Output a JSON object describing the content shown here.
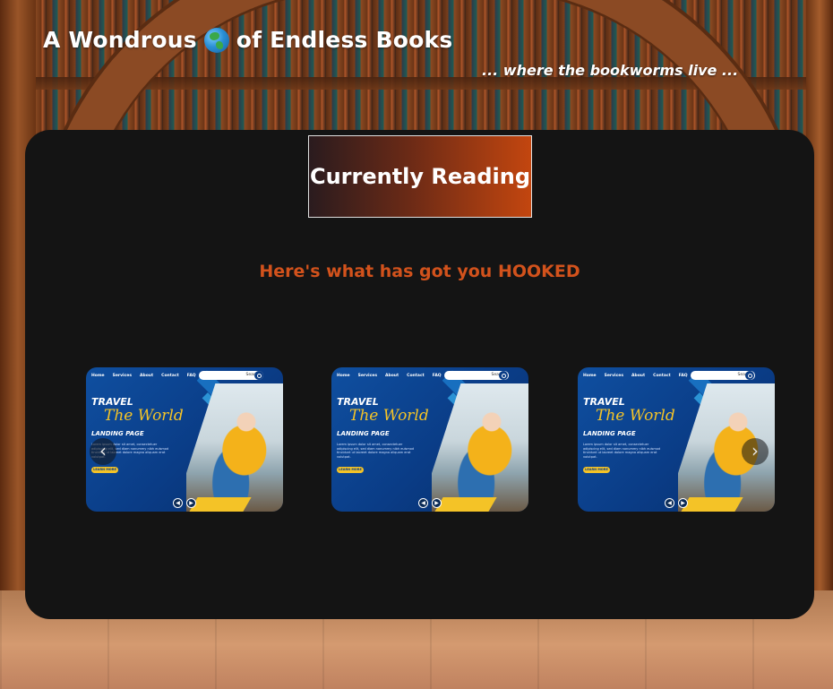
{
  "site": {
    "title_prefix": "A Wondrous",
    "title_suffix": "of Endless Books",
    "tagline": "... where the bookworms live ..."
  },
  "section": {
    "heading": "Currently Reading",
    "subheading": "Here's what has got you HOOKED"
  },
  "cards": [
    {
      "nav": [
        "Home",
        "Services",
        "About",
        "Contact",
        "FAQ"
      ],
      "search": "Search",
      "travel": "TRAVEL",
      "world": "The World",
      "landing": "LANDING PAGE",
      "lorem": "Lorem ipsum dolor sit amet, consectetuer adipiscing elit, sed diam nonummy nibh euismod tincidunt ut laoreet dolore magna aliquam erat volutpat.",
      "button": "LEARN MORE"
    },
    {
      "nav": [
        "Home",
        "Services",
        "About",
        "Contact",
        "FAQ"
      ],
      "search": "Search",
      "travel": "TRAVEL",
      "world": "The World",
      "landing": "LANDING PAGE",
      "lorem": "Lorem ipsum dolor sit amet, consectetuer adipiscing elit, sed diam nonummy nibh euismod tincidunt ut laoreet dolore magna aliquam erat volutpat.",
      "button": "LEARN MORE"
    },
    {
      "nav": [
        "Home",
        "Services",
        "About",
        "Contact",
        "FAQ"
      ],
      "search": "Search",
      "travel": "TRAVEL",
      "world": "The World",
      "landing": "LANDING PAGE",
      "lorem": "Lorem ipsum dolor sit amet, consectetuer adipiscing elit, sed diam nonummy nibh euismod tincidunt ut laoreet dolore magna aliquam erat volutpat.",
      "button": "LEARN MORE"
    }
  ],
  "carousel": {
    "prev_icon": "‹",
    "next_icon": "›"
  },
  "icons": {
    "globe": "globe-icon",
    "prev": "chevron-left-icon",
    "next": "chevron-right-icon"
  },
  "colors": {
    "panel": "#141414",
    "accent": "#d2521c",
    "heading_gradient_start": "#2a1b1e",
    "heading_gradient_end": "#c3460f"
  }
}
